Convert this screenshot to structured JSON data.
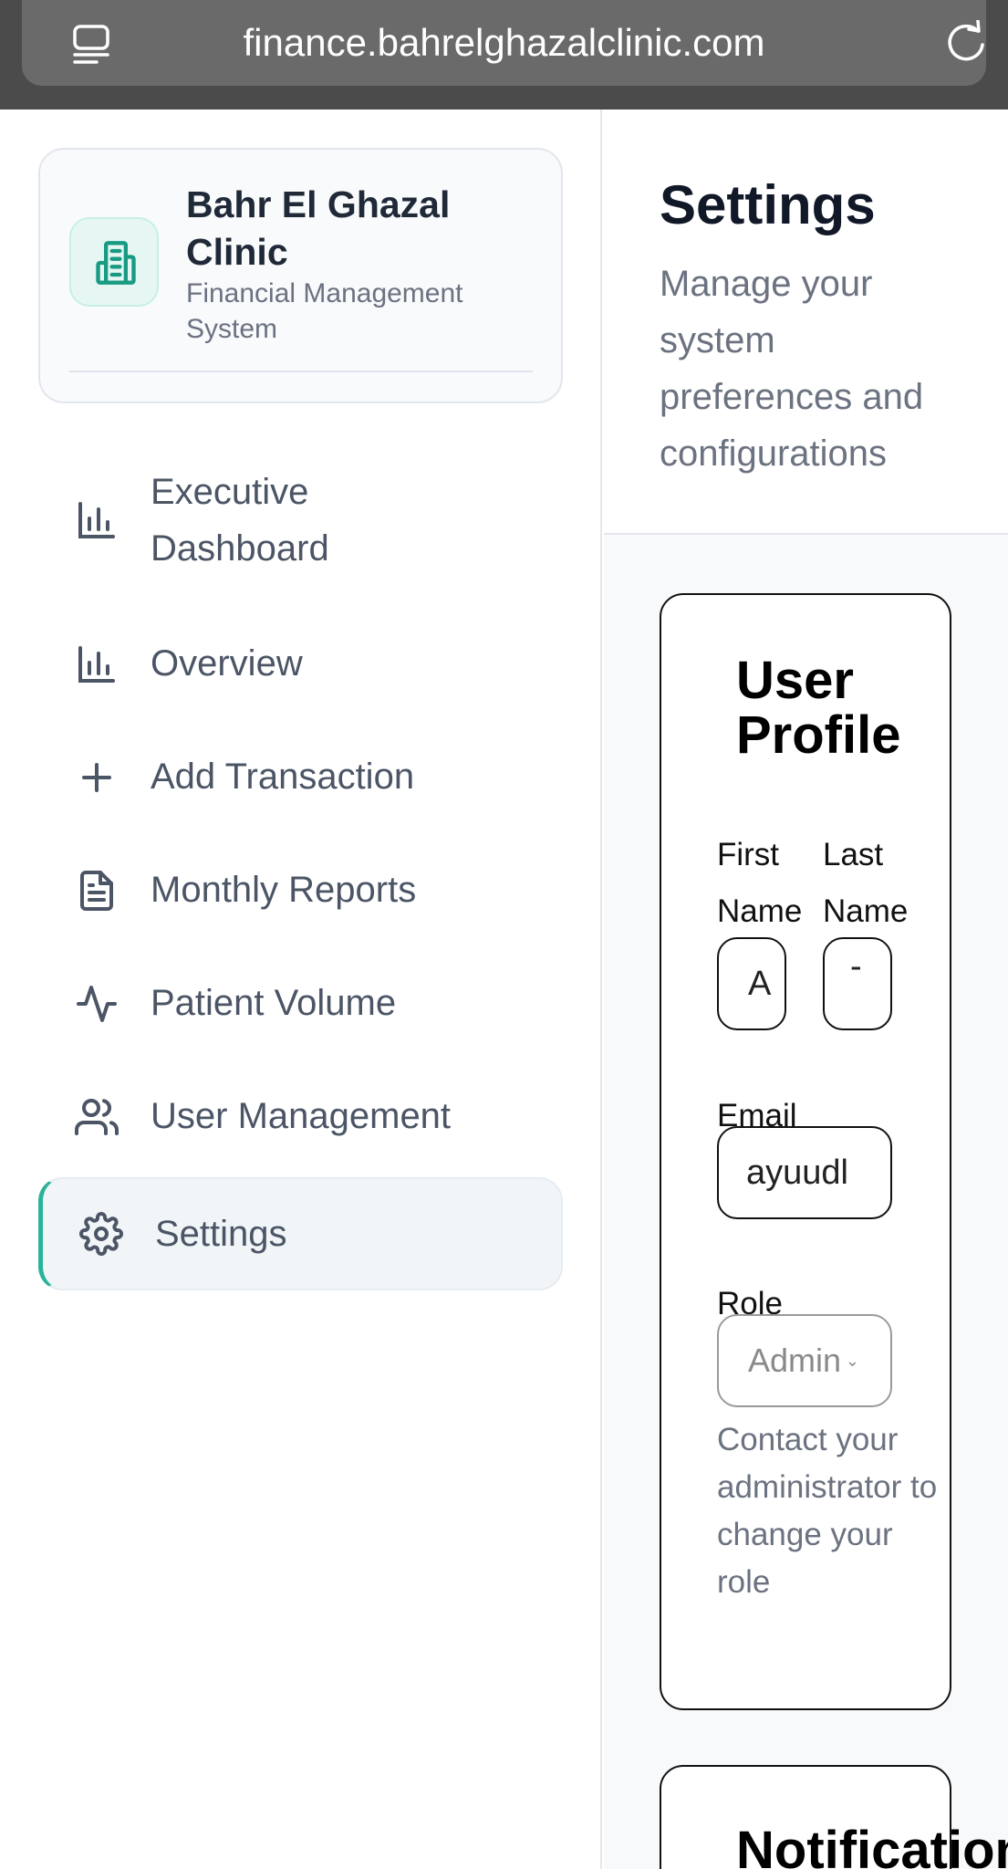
{
  "browser": {
    "url": "finance.bahrelghazalclinic.com"
  },
  "brand": {
    "name": "Bahr El Ghazal Clinic",
    "subtitle": "Financial Management System"
  },
  "nav": [
    {
      "label": "Executive Dashboard",
      "icon": "bar-chart-icon",
      "active": false
    },
    {
      "label": "Overview",
      "icon": "bar-chart-icon",
      "active": false
    },
    {
      "label": "Add Transaction",
      "icon": "plus-icon",
      "active": false
    },
    {
      "label": "Monthly Reports",
      "icon": "file-text-icon",
      "active": false
    },
    {
      "label": "Patient Volume",
      "icon": "activity-icon",
      "active": false
    },
    {
      "label": "User Management",
      "icon": "users-icon",
      "active": false
    },
    {
      "label": "Settings",
      "icon": "gear-icon",
      "active": true
    }
  ],
  "page": {
    "title": "Settings",
    "subtitle": "Manage your system preferences and configurations"
  },
  "profile": {
    "title": "User Profile",
    "first_name_label": "First Name",
    "last_name_label": "Last Name",
    "first_name_value": "A",
    "last_name_value": "-",
    "email_label": "Email",
    "email_value": "ayuudl",
    "role_label": "Role",
    "role_value": "Admin",
    "role_hint": "Contact your administrator to change your role"
  },
  "notifications": {
    "title": "Notifications"
  },
  "colors": {
    "accent": "#2bb39a",
    "brand_icon_bg": "#e6f7f3"
  }
}
